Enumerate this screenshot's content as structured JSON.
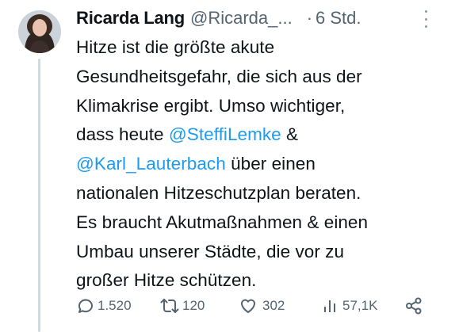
{
  "author": {
    "name": "Ricarda Lang",
    "handle": "@Ricarda_...",
    "separator": "·",
    "time": "6 Std."
  },
  "tweet": {
    "lines": [
      [
        {
          "text": "Hitze ist die größte akute",
          "mention": false
        }
      ],
      [
        {
          "text": "Gesundheitsgefahr, die sich aus der",
          "mention": false
        }
      ],
      [
        {
          "text": "Klimakrise ergibt. Umso wichtiger,",
          "mention": false
        }
      ],
      [
        {
          "text": "dass heute ",
          "mention": false
        },
        {
          "text": "@SteffiLemke",
          "mention": true
        },
        {
          "text": " &",
          "mention": false
        }
      ],
      [
        {
          "text": "@Karl_Lauterbach",
          "mention": true
        },
        {
          "text": " über einen",
          "mention": false
        }
      ],
      [
        {
          "text": "nationalen Hitzeschutzplan beraten.",
          "mention": false
        }
      ],
      [
        {
          "text": "Es braucht Akutmaßnahmen & einen",
          "mention": false
        }
      ],
      [
        {
          "text": "Umbau unserer Städte, die vor zu",
          "mention": false
        }
      ],
      [
        {
          "text": "großer Hitze schützen.",
          "mention": false
        }
      ]
    ]
  },
  "actions": {
    "replies": "1.520",
    "retweets": "120",
    "likes": "302",
    "views": "57,1K"
  },
  "colors": {
    "text": "#0f1419",
    "secondary": "#536471",
    "mention": "#1d9bf0",
    "thread_line": "#cfd9de"
  },
  "icons": [
    "more-horizontal-icon",
    "reply-icon",
    "retweet-icon",
    "like-icon",
    "views-icon",
    "share-icon"
  ]
}
